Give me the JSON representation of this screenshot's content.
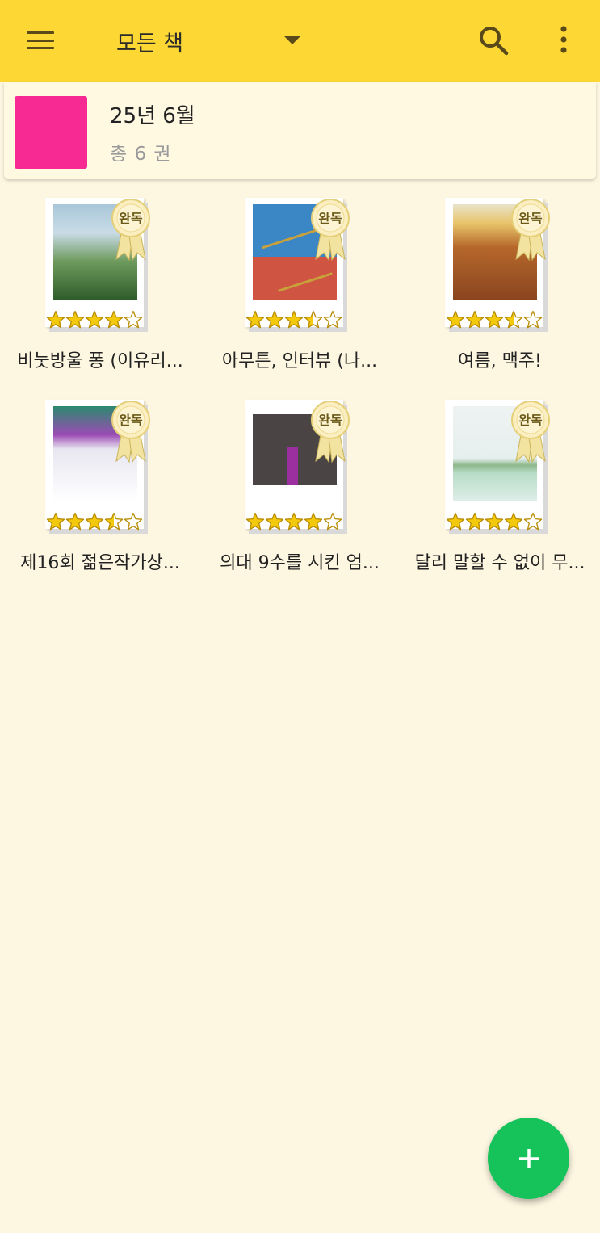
{
  "app_bar": {
    "title": "모든 책",
    "menu_icon": "menu-icon",
    "dropdown_icon": "dropdown-arrow-icon",
    "search_icon": "search-icon",
    "more_icon": "more-vert-icon",
    "background": "#fdd835"
  },
  "shelf": {
    "name": "25년 6월",
    "count_text": "총 6 권",
    "color": "#f72a93"
  },
  "badge_text": "완독",
  "books": [
    {
      "title": "비눗방울 퐁 (이유리...",
      "rating": 4,
      "max_rating": 5
    },
    {
      "title": "아무튼, 인터뷰 (나...",
      "rating": 3.5,
      "max_rating": 5
    },
    {
      "title": "여름, 맥주!",
      "rating": 3.5,
      "max_rating": 5
    },
    {
      "title": "제16회 젊은작가상...",
      "rating": 3.5,
      "max_rating": 5
    },
    {
      "title": "의대 9수를 시킨 엄...",
      "rating": 4,
      "max_rating": 5
    },
    {
      "title": "달리 말할 수 없이 무...",
      "rating": 4,
      "max_rating": 5
    }
  ],
  "fab": {
    "icon": "plus-icon",
    "color": "#16c35b"
  }
}
